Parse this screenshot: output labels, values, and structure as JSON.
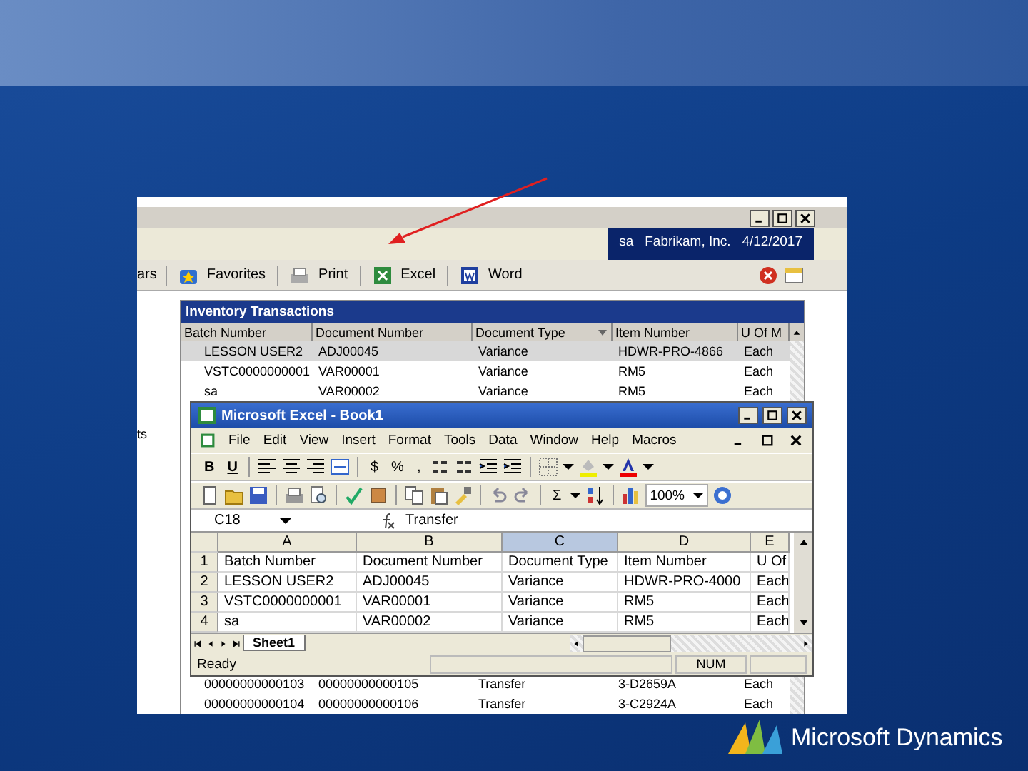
{
  "slide": {
    "brand": "Microsoft Dynamics"
  },
  "gp": {
    "left_text": "ts",
    "company": "sa   Fabrikam, Inc.   4/12/2017",
    "toolbar": [
      {
        "kind": "text",
        "label": "ars"
      },
      {
        "kind": "favorites",
        "label": "Favorites"
      },
      {
        "kind": "print",
        "label": "Print"
      },
      {
        "kind": "excel",
        "label": "Excel"
      },
      {
        "kind": "word",
        "label": "Word"
      }
    ],
    "table": {
      "title": "Inventory Transactions",
      "columns": [
        {
          "label": "Batch Number",
          "sorted": false
        },
        {
          "label": "Document Number",
          "sorted": false
        },
        {
          "label": "Document Type",
          "sorted": true
        },
        {
          "label": "Item Number",
          "sorted": false
        },
        {
          "label": "U Of M",
          "sorted": false
        }
      ],
      "rows_top": [
        {
          "cells": [
            "LESSON USER2",
            "ADJ00045",
            "Variance",
            "HDWR-PRO-4866",
            "Each"
          ],
          "selected": true
        },
        {
          "cells": [
            "VSTC0000000001",
            "VAR00001",
            "Variance",
            "RM5",
            "Each"
          ],
          "selected": false
        },
        {
          "cells": [
            "sa",
            "VAR00002",
            "Variance",
            "RM5",
            "Each"
          ],
          "selected": false
        }
      ],
      "rows_bottom": [
        {
          "cells": [
            "00000000000103",
            "00000000000105",
            "Transfer",
            "3-D2659A",
            "Each"
          ],
          "selected": false
        },
        {
          "cells": [
            "00000000000104",
            "00000000000106",
            "Transfer",
            "3-C2924A",
            "Each"
          ],
          "selected": false
        }
      ]
    }
  },
  "excel": {
    "title": "Microsoft Excel - Book1",
    "menu": [
      "File",
      "Edit",
      "View",
      "Insert",
      "Format",
      "Tools",
      "Data",
      "Window",
      "Help",
      "Macros"
    ],
    "style_buttons": [
      "B",
      "U"
    ],
    "number_buttons": [
      "$",
      "%",
      ","
    ],
    "autosum": "Σ",
    "zoom": "100%",
    "name_box": "C18",
    "formula": "Transfer",
    "columns": [
      {
        "label": "A",
        "selected": false
      },
      {
        "label": "B",
        "selected": false
      },
      {
        "label": "C",
        "selected": true
      },
      {
        "label": "D",
        "selected": false
      },
      {
        "label": "E",
        "selected": false
      }
    ],
    "rows": [
      {
        "number": "1",
        "cells": [
          "Batch Number",
          "Document Number",
          "Document Type",
          "Item Number",
          "U Of"
        ]
      },
      {
        "number": "2",
        "cells": [
          "LESSON USER2",
          "ADJ00045",
          "Variance",
          "HDWR-PRO-4000",
          "Each"
        ]
      },
      {
        "number": "3",
        "cells": [
          "VSTC0000000001",
          "VAR00001",
          "Variance",
          "RM5",
          "Each"
        ]
      },
      {
        "number": "4",
        "cells": [
          "sa",
          "VAR00002",
          "Variance",
          "RM5",
          "Each"
        ]
      }
    ],
    "sheet_tab": "Sheet1",
    "status": "Ready",
    "num": "NUM"
  }
}
